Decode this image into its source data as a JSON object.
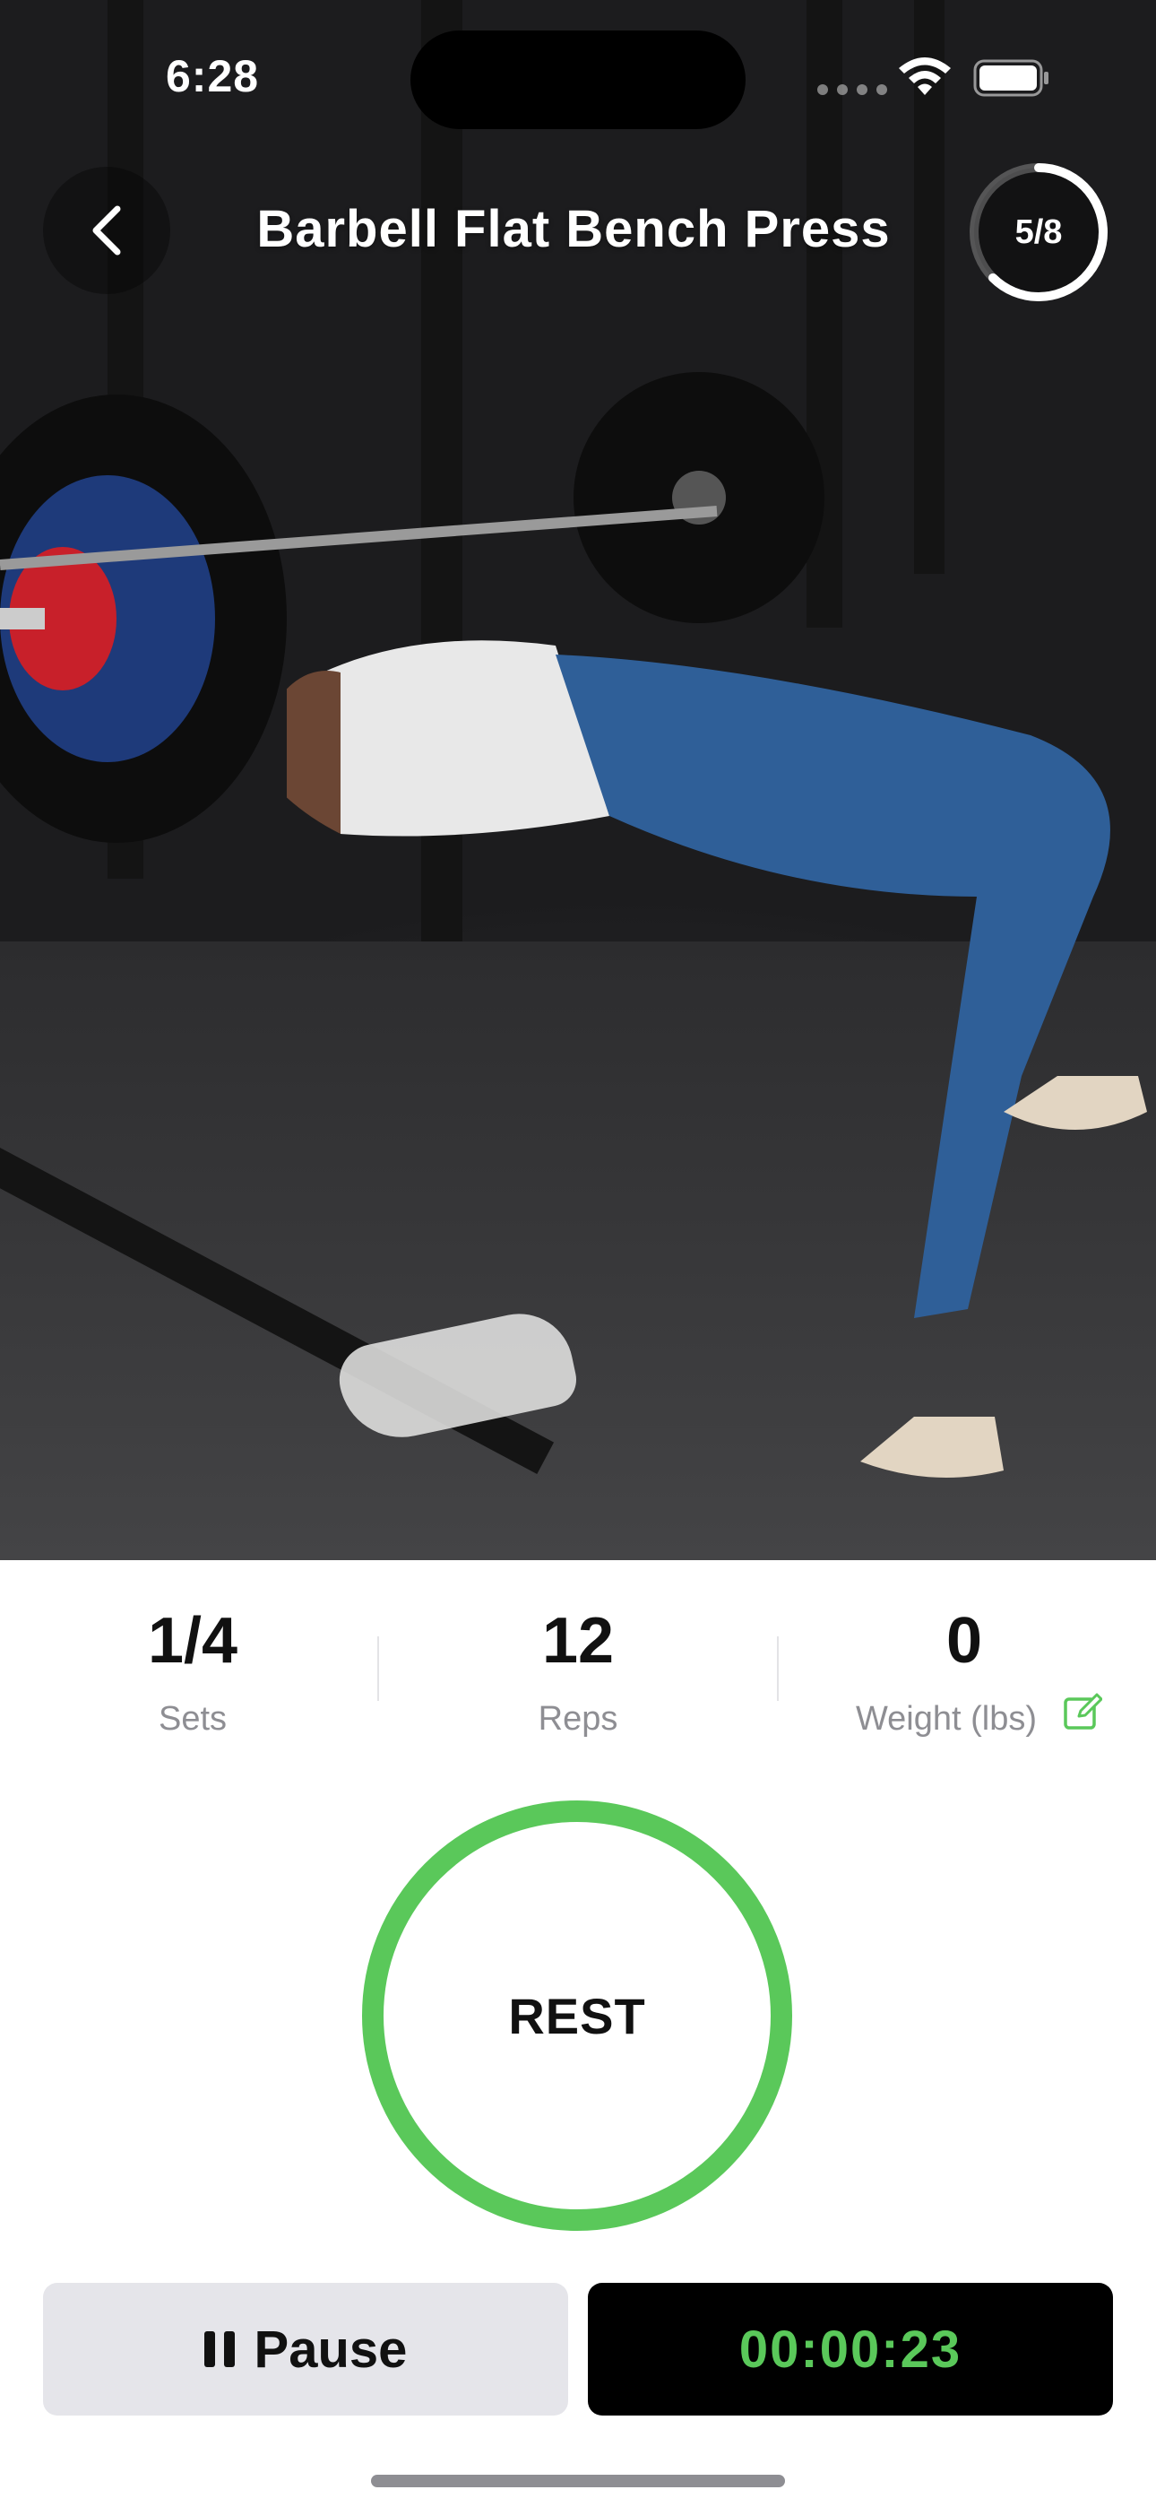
{
  "status_bar": {
    "time": "6:28"
  },
  "header": {
    "back_icon": "chevron-left-icon",
    "title": "Barbell Flat Bench Press",
    "progress": {
      "text": "5/8",
      "current": 5,
      "total": 8
    }
  },
  "stats": {
    "sets": {
      "value": "1/4",
      "label": "Sets"
    },
    "reps": {
      "value": "12",
      "label": "Reps"
    },
    "weight": {
      "value": "0",
      "label": "Weight (lbs)",
      "edit_icon": "edit-icon"
    }
  },
  "rest": {
    "label": "REST",
    "ring_color": "#5ac85a"
  },
  "controls": {
    "pause_label": "Pause",
    "pause_icon": "pause-icon",
    "timer": "00:00:23",
    "timer_color": "#5ac85a"
  },
  "colors": {
    "accent_green": "#5ac85a",
    "button_gray": "#e5e5ea",
    "secondary_text": "#8e8e93"
  }
}
